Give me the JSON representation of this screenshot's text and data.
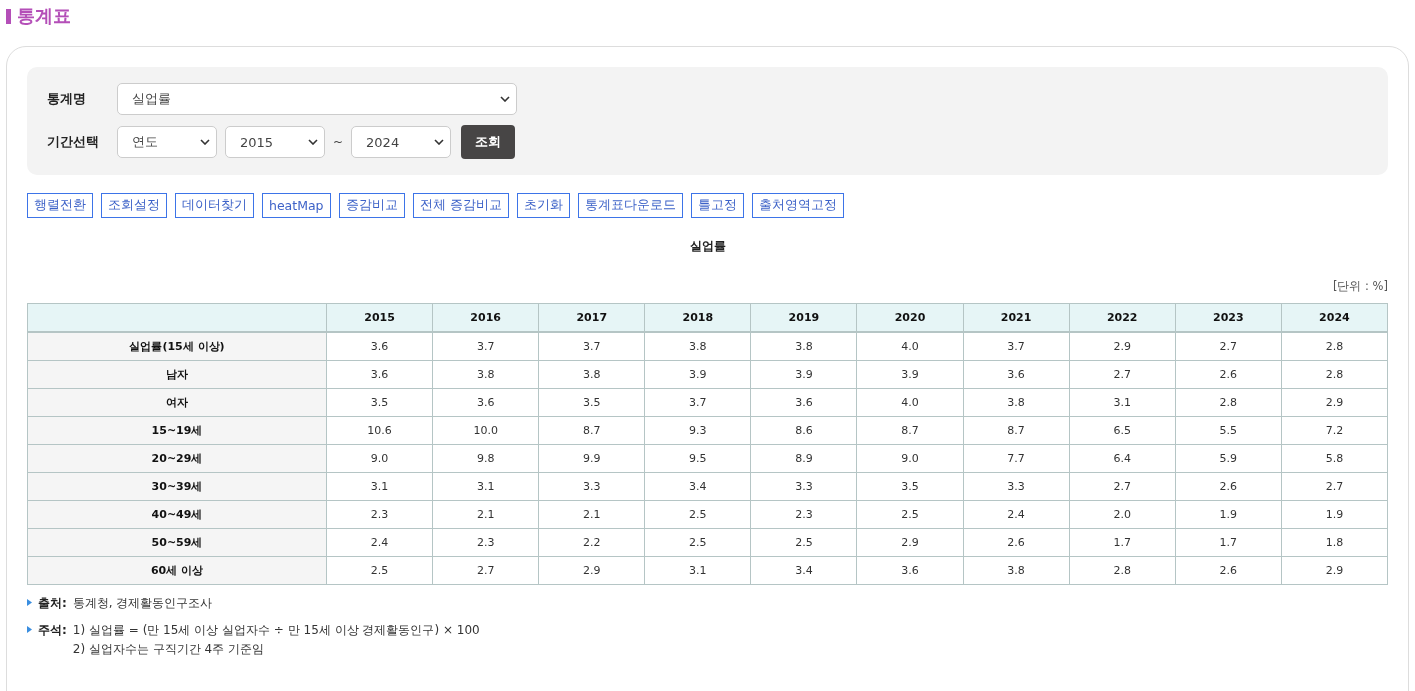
{
  "page_title": "통계표",
  "filters": {
    "stat_label": "통계명",
    "stat_value": "실업률",
    "period_label": "기간선택",
    "period_type": "연도",
    "from_year": "2015",
    "separator": "~",
    "to_year": "2024",
    "search_button": "조회"
  },
  "tools": [
    {
      "label": "행렬전환"
    },
    {
      "label": "조회설정"
    },
    {
      "label": "데이터찾기"
    },
    {
      "label": "heatMap"
    },
    {
      "label": "증감비교"
    },
    {
      "label": "전체 증감비교"
    },
    {
      "label": "초기화"
    },
    {
      "label": "통계표다운로드"
    },
    {
      "label": "틀고정"
    },
    {
      "label": "출처영역고정"
    }
  ],
  "table_title": "실업률",
  "unit": "[단위 : %]",
  "table": {
    "columns": [
      "2015",
      "2016",
      "2017",
      "2018",
      "2019",
      "2020",
      "2021",
      "2022",
      "2023",
      "2024"
    ],
    "rows": [
      {
        "label": "실업률(15세 이상)",
        "values": [
          "3.6",
          "3.7",
          "3.7",
          "3.8",
          "3.8",
          "4.0",
          "3.7",
          "2.9",
          "2.7",
          "2.8"
        ]
      },
      {
        "label": "남자",
        "values": [
          "3.6",
          "3.8",
          "3.8",
          "3.9",
          "3.9",
          "3.9",
          "3.6",
          "2.7",
          "2.6",
          "2.8"
        ]
      },
      {
        "label": "여자",
        "values": [
          "3.5",
          "3.6",
          "3.5",
          "3.7",
          "3.6",
          "4.0",
          "3.8",
          "3.1",
          "2.8",
          "2.9"
        ]
      },
      {
        "label": "15~19세",
        "values": [
          "10.6",
          "10.0",
          "8.7",
          "9.3",
          "8.6",
          "8.7",
          "8.7",
          "6.5",
          "5.5",
          "7.2"
        ]
      },
      {
        "label": "20~29세",
        "values": [
          "9.0",
          "9.8",
          "9.9",
          "9.5",
          "8.9",
          "9.0",
          "7.7",
          "6.4",
          "5.9",
          "5.8"
        ]
      },
      {
        "label": "30~39세",
        "values": [
          "3.1",
          "3.1",
          "3.3",
          "3.4",
          "3.3",
          "3.5",
          "3.3",
          "2.7",
          "2.6",
          "2.7"
        ]
      },
      {
        "label": "40~49세",
        "values": [
          "2.3",
          "2.1",
          "2.1",
          "2.5",
          "2.3",
          "2.5",
          "2.4",
          "2.0",
          "1.9",
          "1.9"
        ]
      },
      {
        "label": "50~59세",
        "values": [
          "2.4",
          "2.3",
          "2.2",
          "2.5",
          "2.5",
          "2.9",
          "2.6",
          "1.7",
          "1.7",
          "1.8"
        ]
      },
      {
        "label": "60세 이상",
        "values": [
          "2.5",
          "2.7",
          "2.9",
          "3.1",
          "3.4",
          "3.6",
          "3.8",
          "2.8",
          "2.6",
          "2.9"
        ]
      }
    ]
  },
  "source": {
    "label": "출처:",
    "text": "통계청, 경제활동인구조사"
  },
  "notes": {
    "label": "주석:",
    "lines": [
      "1) 실업률 = (만 15세 이상 실업자수 ÷ 만 15세 이상 경제활동인구) × 100",
      "2) 실업자수는 구직기간 4주 기준임"
    ]
  }
}
